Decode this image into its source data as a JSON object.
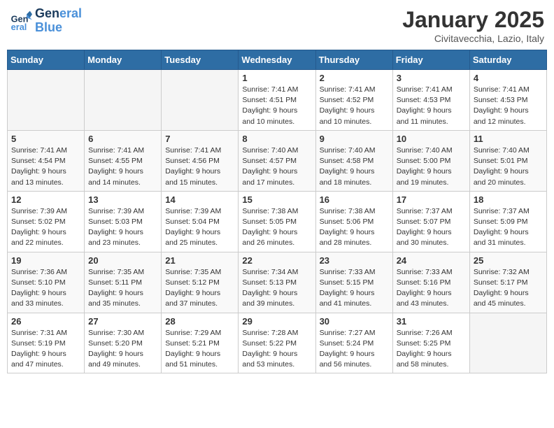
{
  "header": {
    "logo_line1": "General",
    "logo_line2": "Blue",
    "month": "January 2025",
    "location": "Civitavecchia, Lazio, Italy"
  },
  "weekdays": [
    "Sunday",
    "Monday",
    "Tuesday",
    "Wednesday",
    "Thursday",
    "Friday",
    "Saturday"
  ],
  "weeks": [
    [
      {
        "day": "",
        "sunrise": "",
        "sunset": "",
        "daylight": "",
        "empty": true
      },
      {
        "day": "",
        "sunrise": "",
        "sunset": "",
        "daylight": "",
        "empty": true
      },
      {
        "day": "",
        "sunrise": "",
        "sunset": "",
        "daylight": "",
        "empty": true
      },
      {
        "day": "1",
        "sunrise": "Sunrise: 7:41 AM",
        "sunset": "Sunset: 4:51 PM",
        "daylight": "Daylight: 9 hours and 10 minutes."
      },
      {
        "day": "2",
        "sunrise": "Sunrise: 7:41 AM",
        "sunset": "Sunset: 4:52 PM",
        "daylight": "Daylight: 9 hours and 10 minutes."
      },
      {
        "day": "3",
        "sunrise": "Sunrise: 7:41 AM",
        "sunset": "Sunset: 4:53 PM",
        "daylight": "Daylight: 9 hours and 11 minutes."
      },
      {
        "day": "4",
        "sunrise": "Sunrise: 7:41 AM",
        "sunset": "Sunset: 4:53 PM",
        "daylight": "Daylight: 9 hours and 12 minutes."
      }
    ],
    [
      {
        "day": "5",
        "sunrise": "Sunrise: 7:41 AM",
        "sunset": "Sunset: 4:54 PM",
        "daylight": "Daylight: 9 hours and 13 minutes."
      },
      {
        "day": "6",
        "sunrise": "Sunrise: 7:41 AM",
        "sunset": "Sunset: 4:55 PM",
        "daylight": "Daylight: 9 hours and 14 minutes."
      },
      {
        "day": "7",
        "sunrise": "Sunrise: 7:41 AM",
        "sunset": "Sunset: 4:56 PM",
        "daylight": "Daylight: 9 hours and 15 minutes."
      },
      {
        "day": "8",
        "sunrise": "Sunrise: 7:40 AM",
        "sunset": "Sunset: 4:57 PM",
        "daylight": "Daylight: 9 hours and 17 minutes."
      },
      {
        "day": "9",
        "sunrise": "Sunrise: 7:40 AM",
        "sunset": "Sunset: 4:58 PM",
        "daylight": "Daylight: 9 hours and 18 minutes."
      },
      {
        "day": "10",
        "sunrise": "Sunrise: 7:40 AM",
        "sunset": "Sunset: 5:00 PM",
        "daylight": "Daylight: 9 hours and 19 minutes."
      },
      {
        "day": "11",
        "sunrise": "Sunrise: 7:40 AM",
        "sunset": "Sunset: 5:01 PM",
        "daylight": "Daylight: 9 hours and 20 minutes."
      }
    ],
    [
      {
        "day": "12",
        "sunrise": "Sunrise: 7:39 AM",
        "sunset": "Sunset: 5:02 PM",
        "daylight": "Daylight: 9 hours and 22 minutes."
      },
      {
        "day": "13",
        "sunrise": "Sunrise: 7:39 AM",
        "sunset": "Sunset: 5:03 PM",
        "daylight": "Daylight: 9 hours and 23 minutes."
      },
      {
        "day": "14",
        "sunrise": "Sunrise: 7:39 AM",
        "sunset": "Sunset: 5:04 PM",
        "daylight": "Daylight: 9 hours and 25 minutes."
      },
      {
        "day": "15",
        "sunrise": "Sunrise: 7:38 AM",
        "sunset": "Sunset: 5:05 PM",
        "daylight": "Daylight: 9 hours and 26 minutes."
      },
      {
        "day": "16",
        "sunrise": "Sunrise: 7:38 AM",
        "sunset": "Sunset: 5:06 PM",
        "daylight": "Daylight: 9 hours and 28 minutes."
      },
      {
        "day": "17",
        "sunrise": "Sunrise: 7:37 AM",
        "sunset": "Sunset: 5:07 PM",
        "daylight": "Daylight: 9 hours and 30 minutes."
      },
      {
        "day": "18",
        "sunrise": "Sunrise: 7:37 AM",
        "sunset": "Sunset: 5:09 PM",
        "daylight": "Daylight: 9 hours and 31 minutes."
      }
    ],
    [
      {
        "day": "19",
        "sunrise": "Sunrise: 7:36 AM",
        "sunset": "Sunset: 5:10 PM",
        "daylight": "Daylight: 9 hours and 33 minutes."
      },
      {
        "day": "20",
        "sunrise": "Sunrise: 7:35 AM",
        "sunset": "Sunset: 5:11 PM",
        "daylight": "Daylight: 9 hours and 35 minutes."
      },
      {
        "day": "21",
        "sunrise": "Sunrise: 7:35 AM",
        "sunset": "Sunset: 5:12 PM",
        "daylight": "Daylight: 9 hours and 37 minutes."
      },
      {
        "day": "22",
        "sunrise": "Sunrise: 7:34 AM",
        "sunset": "Sunset: 5:13 PM",
        "daylight": "Daylight: 9 hours and 39 minutes."
      },
      {
        "day": "23",
        "sunrise": "Sunrise: 7:33 AM",
        "sunset": "Sunset: 5:15 PM",
        "daylight": "Daylight: 9 hours and 41 minutes."
      },
      {
        "day": "24",
        "sunrise": "Sunrise: 7:33 AM",
        "sunset": "Sunset: 5:16 PM",
        "daylight": "Daylight: 9 hours and 43 minutes."
      },
      {
        "day": "25",
        "sunrise": "Sunrise: 7:32 AM",
        "sunset": "Sunset: 5:17 PM",
        "daylight": "Daylight: 9 hours and 45 minutes."
      }
    ],
    [
      {
        "day": "26",
        "sunrise": "Sunrise: 7:31 AM",
        "sunset": "Sunset: 5:19 PM",
        "daylight": "Daylight: 9 hours and 47 minutes."
      },
      {
        "day": "27",
        "sunrise": "Sunrise: 7:30 AM",
        "sunset": "Sunset: 5:20 PM",
        "daylight": "Daylight: 9 hours and 49 minutes."
      },
      {
        "day": "28",
        "sunrise": "Sunrise: 7:29 AM",
        "sunset": "Sunset: 5:21 PM",
        "daylight": "Daylight: 9 hours and 51 minutes."
      },
      {
        "day": "29",
        "sunrise": "Sunrise: 7:28 AM",
        "sunset": "Sunset: 5:22 PM",
        "daylight": "Daylight: 9 hours and 53 minutes."
      },
      {
        "day": "30",
        "sunrise": "Sunrise: 7:27 AM",
        "sunset": "Sunset: 5:24 PM",
        "daylight": "Daylight: 9 hours and 56 minutes."
      },
      {
        "day": "31",
        "sunrise": "Sunrise: 7:26 AM",
        "sunset": "Sunset: 5:25 PM",
        "daylight": "Daylight: 9 hours and 58 minutes."
      },
      {
        "day": "",
        "sunrise": "",
        "sunset": "",
        "daylight": "",
        "empty": true
      }
    ]
  ]
}
